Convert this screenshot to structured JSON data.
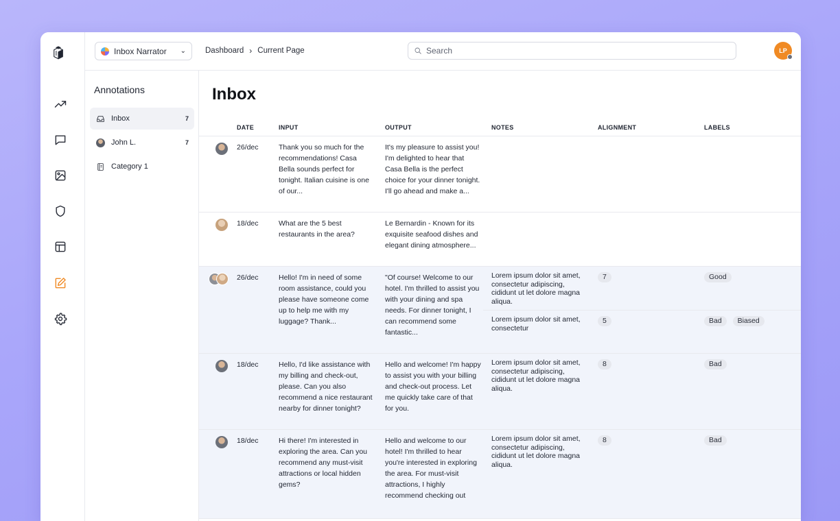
{
  "app": {
    "project": "Inbox Narrator",
    "breadcrumb": [
      "Dashboard",
      "Current Page"
    ],
    "breadcrumb_sep": "›",
    "search_placeholder": "Search",
    "user_initials": "LP",
    "accent_color": "#f08a24"
  },
  "rail": {
    "items": [
      "trending-up-icon",
      "chat-icon",
      "image-icon",
      "shield-icon",
      "layout-icon",
      "edit-icon",
      "gear-icon"
    ],
    "active": "edit-icon"
  },
  "annotations": {
    "title": "Annotations",
    "items": [
      {
        "label": "Inbox",
        "count": "7"
      },
      {
        "label": "John L.",
        "count": "7"
      },
      {
        "label": "Category 1",
        "count": ""
      }
    ]
  },
  "main": {
    "title": "Inbox",
    "columns": [
      "DATE",
      "INPUT",
      "OUTPUT",
      "NOTES",
      "ALIGNMENT",
      "LABELS"
    ],
    "rows": [
      {
        "date": "26/dec",
        "input": "Thank you so much for the recommendations! Casa Bella sounds perfect for tonight. Italian cuisine is one of our...",
        "output": "It's my pleasure to assist you! I'm delighted to hear that Casa Bella is the perfect choice for your dinner tonight. I'll go ahead and make a...",
        "annotations": []
      },
      {
        "date": "18/dec",
        "input": "What are the 5 best restaurants in the area?",
        "output": "Le Bernardin - Known for its exquisite seafood dishes and elegant dining atmosphere...",
        "annotations": []
      },
      {
        "date": "26/dec",
        "input": "Hello! I'm in need of some room assistance, could you please have someone come up to help me with my luggage? Thank...",
        "output": "\"Of course!  Welcome to our hotel. I'm thrilled to assist you with your dining and  spa needs. For dinner tonight, I can recommend some fantastic...",
        "annotations": [
          {
            "note": "Lorem ipsum dolor sit amet, consectetur adipiscing, cididunt ut let dolore magna aliqua.",
            "alignment": "7",
            "labels": [
              "Good"
            ]
          },
          {
            "note": "Lorem ipsum dolor sit amet, consectetur",
            "alignment": "5",
            "labels": [
              "Bad",
              "Biased"
            ]
          }
        ]
      },
      {
        "date": "18/dec",
        "input": "Hello, I'd like assistance with my billing and check-out, please. Can you also recommend a nice restaurant nearby for dinner tonight?",
        "output": "Hello and welcome! I'm happy to assist you with your billing and check-out process. Let me quickly take care of that for you.",
        "annotations": [
          {
            "note": "Lorem ipsum dolor sit amet, consectetur adipiscing, cididunt ut let dolore magna aliqua.",
            "alignment": "8",
            "labels": [
              "Bad"
            ]
          }
        ]
      },
      {
        "date": "18/dec",
        "input": "Hi there! I'm interested in exploring the area. Can you recommend any must-visit attractions or local hidden gems?",
        "output": "Hello and welcome to our hotel! I'm thrilled to hear you're interested in exploring the area. For must-visit attractions, I highly recommend checking out",
        "annotations": [
          {
            "note": "Lorem ipsum dolor sit amet, consectetur adipiscing, cididunt ut let dolore magna aliqua.",
            "alignment": "8",
            "labels": [
              "Bad"
            ]
          }
        ]
      }
    ]
  }
}
